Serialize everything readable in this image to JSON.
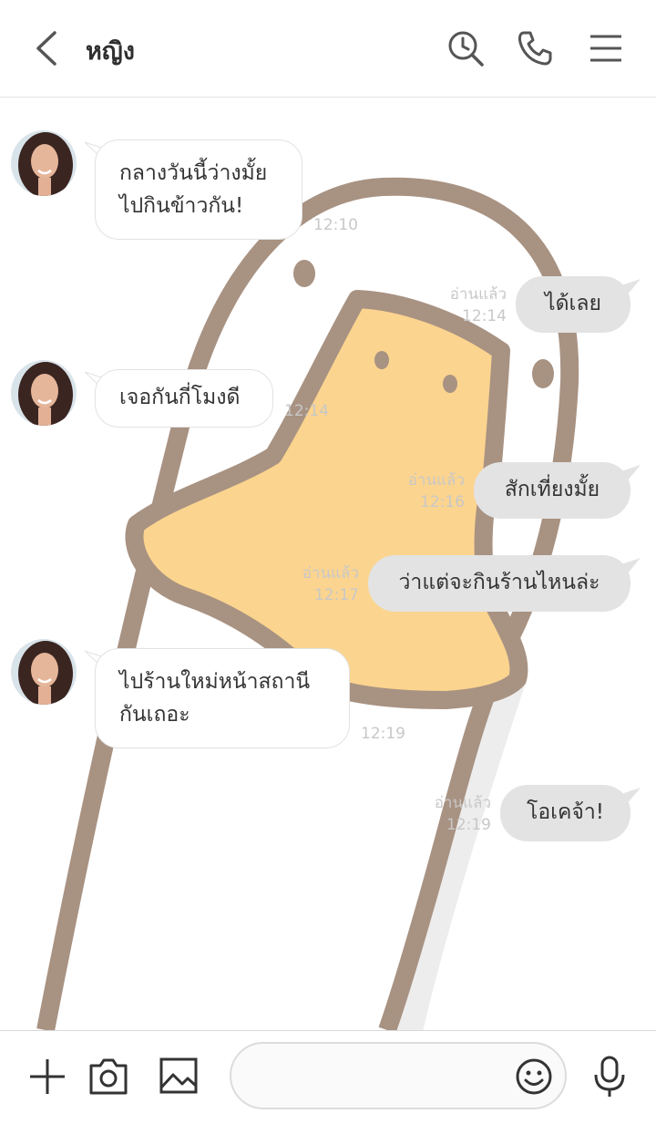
{
  "header": {
    "title": "หญิง",
    "back_icon": "chevron-left-icon",
    "search_icon": "search-clock-icon",
    "call_icon": "phone-icon",
    "menu_icon": "hamburger-icon"
  },
  "messages": [
    {
      "direction": "in",
      "lines": [
        "กลางวันนี้ว่างมั้ย",
        "ไปกินข้าวกัน!"
      ],
      "time": "12:10"
    },
    {
      "direction": "out",
      "text": "ได้เลย",
      "read": "อ่านแล้ว",
      "time": "12:14"
    },
    {
      "direction": "in",
      "lines": [
        "เจอกันกี่โมงดี"
      ],
      "time": "12:14"
    },
    {
      "direction": "out",
      "text": "สักเที่ยงมั้ย",
      "read": "อ่านแล้ว",
      "time": "12:16"
    },
    {
      "direction": "out",
      "text": "ว่าแต่จะกินร้านไหนล่ะ",
      "read": "อ่านแล้ว",
      "time": "12:17"
    },
    {
      "direction": "in",
      "lines": [
        "ไปร้านใหม่หน้าสถานี",
        "กันเถอะ"
      ],
      "time": "12:19"
    },
    {
      "direction": "out",
      "text": "โอเคจ้า!",
      "read": "อ่านแล้ว",
      "time": "12:19"
    }
  ],
  "composer": {
    "placeholder": "",
    "plus_icon": "plus-icon",
    "camera_icon": "camera-icon",
    "image_icon": "image-icon",
    "emoji_icon": "emoji-icon",
    "mic_icon": "microphone-icon"
  },
  "colors": {
    "outgoing_bubble": "#e3e3e3",
    "incoming_bubble": "#ffffff",
    "duck_body": "#a89282",
    "duck_beak": "#fbd48f"
  }
}
